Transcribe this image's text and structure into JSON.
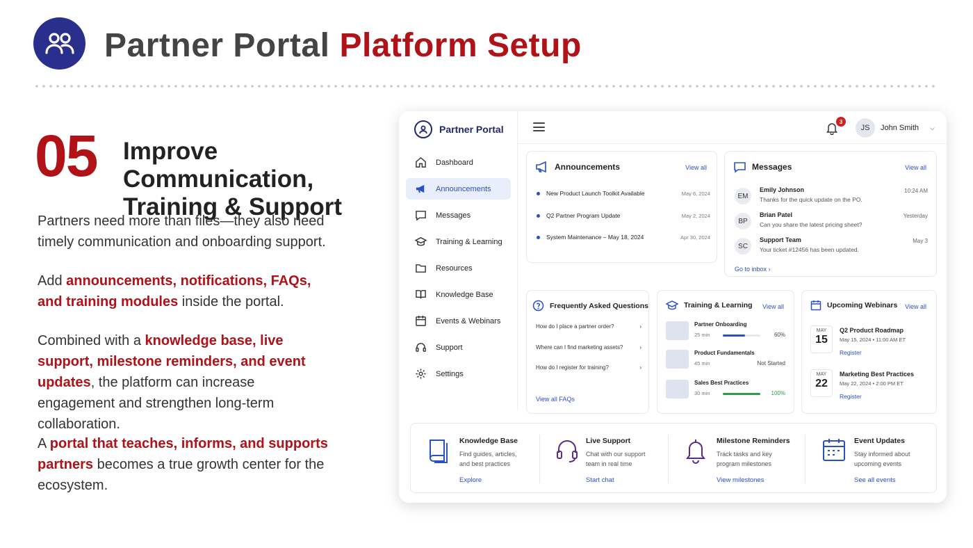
{
  "header": {
    "title_part1": "Partner Portal",
    "title_part2": "Platform Setup",
    "logo_icon": "users-icon"
  },
  "section": {
    "number": "05",
    "title_line1": "Improve Communication,",
    "title_line2": "Training & Support"
  },
  "paragraphs": {
    "p1_line1": "Partners need more than files—they also need",
    "p1_line2": "timely communication and onboarding support.",
    "p2_a": "Add ",
    "p2_hl": "announcements, notifications, FAQs, and training modules",
    "p2_b": " inside the portal.",
    "p3_a": "Combined with a ",
    "p3_hl": "knowledge base, live support, milestone reminders, and event updates",
    "p3_b": ", the platform can increase engagement and strengthen long-term collaboration.",
    "p4_a": "A ",
    "p4_hl": "portal that teaches, informs, and supports partners",
    "p4_b": " becomes a true growth center for the ecosystem."
  },
  "app": {
    "brand": "Partner Portal",
    "nav": [
      {
        "label": "Dashboard",
        "icon": "home-icon"
      },
      {
        "label": "Announcements",
        "icon": "megaphone-icon"
      },
      {
        "label": "Messages",
        "icon": "message-icon"
      },
      {
        "label": "Training & Learning",
        "icon": "graduation-cap-icon"
      },
      {
        "label": "Resources",
        "icon": "folder-icon"
      },
      {
        "label": "Knowledge Base",
        "icon": "book-icon"
      },
      {
        "label": "Events & Webinars",
        "icon": "calendar-icon"
      },
      {
        "label": "Support",
        "icon": "headset-icon"
      },
      {
        "label": "Settings",
        "icon": "gear-icon"
      }
    ],
    "topbar": {
      "notif_count": "3",
      "avatar": "JS",
      "user": "John Smith"
    },
    "announcements": {
      "title": "Announcements",
      "view_all": "View all",
      "items": [
        {
          "text": "New Product Launch Toolkit Available",
          "date": "May 6, 2024"
        },
        {
          "text": "Q2 Partner Program Update",
          "date": "May 2, 2024"
        },
        {
          "text": "System Maintenance – May 18, 2024",
          "date": "Apr 30, 2024"
        }
      ]
    },
    "messages": {
      "title": "Messages",
      "view_all": "View all",
      "link": "Go to inbox ›",
      "items": [
        {
          "initials": "EM",
          "name": "Emily Johnson",
          "preview": "Thanks for the quick update on the PO.",
          "time": "10:24 AM"
        },
        {
          "initials": "BP",
          "name": "Brian Patel",
          "preview": "Can you share the latest pricing sheet?",
          "time": "Yesterday"
        },
        {
          "initials": "SC",
          "name": "Support Team",
          "preview": "Your ticket #12456 has been updated.",
          "time": "May 3"
        }
      ]
    },
    "faq": {
      "title": "Frequently Asked Questions",
      "link": "View all FAQs",
      "items": [
        "How do I place a partner order?",
        "Where can I find marketing assets?",
        "How do I register for training?"
      ]
    },
    "training": {
      "title": "Training & Learning",
      "view_all": "View all",
      "items": [
        {
          "name": "Partner Onboarding",
          "meta": "25 min",
          "status": "60%",
          "progress": 0.6,
          "color": "#2a50c8"
        },
        {
          "name": "Product Fundamentals",
          "meta": "45 min",
          "status": "Not Started",
          "progress": 0,
          "color": "#2a50c8"
        },
        {
          "name": "Sales Best Practices",
          "meta": "30 min",
          "status": "100%",
          "progress": 1,
          "color": "#2e9e44"
        }
      ]
    },
    "webinars": {
      "title": "Upcoming Webinars",
      "view_all": "View all",
      "items": [
        {
          "month": "MAY",
          "day": "15",
          "name": "Q2 Product Roadmap",
          "datetime": "May 15, 2024 • 11:00 AM ET",
          "link": "Register"
        },
        {
          "month": "MAY",
          "day": "22",
          "name": "Marketing Best Practices",
          "datetime": "May 22, 2024 • 2:00 PM ET",
          "link": "Register"
        }
      ]
    },
    "features": [
      {
        "title": "Knowledge Base",
        "desc": "Find guides, articles, and best practices",
        "link": "Explore",
        "icon": "book-icon"
      },
      {
        "title": "Live Support",
        "desc": "Chat with our support team in real time",
        "link": "Start chat",
        "icon": "headset-icon"
      },
      {
        "title": "Milestone Reminders",
        "desc": "Track tasks and key program milestones",
        "link": "View milestones",
        "icon": "bell-icon"
      },
      {
        "title": "Event Updates",
        "desc": "Stay informed about upcoming events",
        "link": "See all events",
        "icon": "calendar-icon"
      }
    ]
  }
}
